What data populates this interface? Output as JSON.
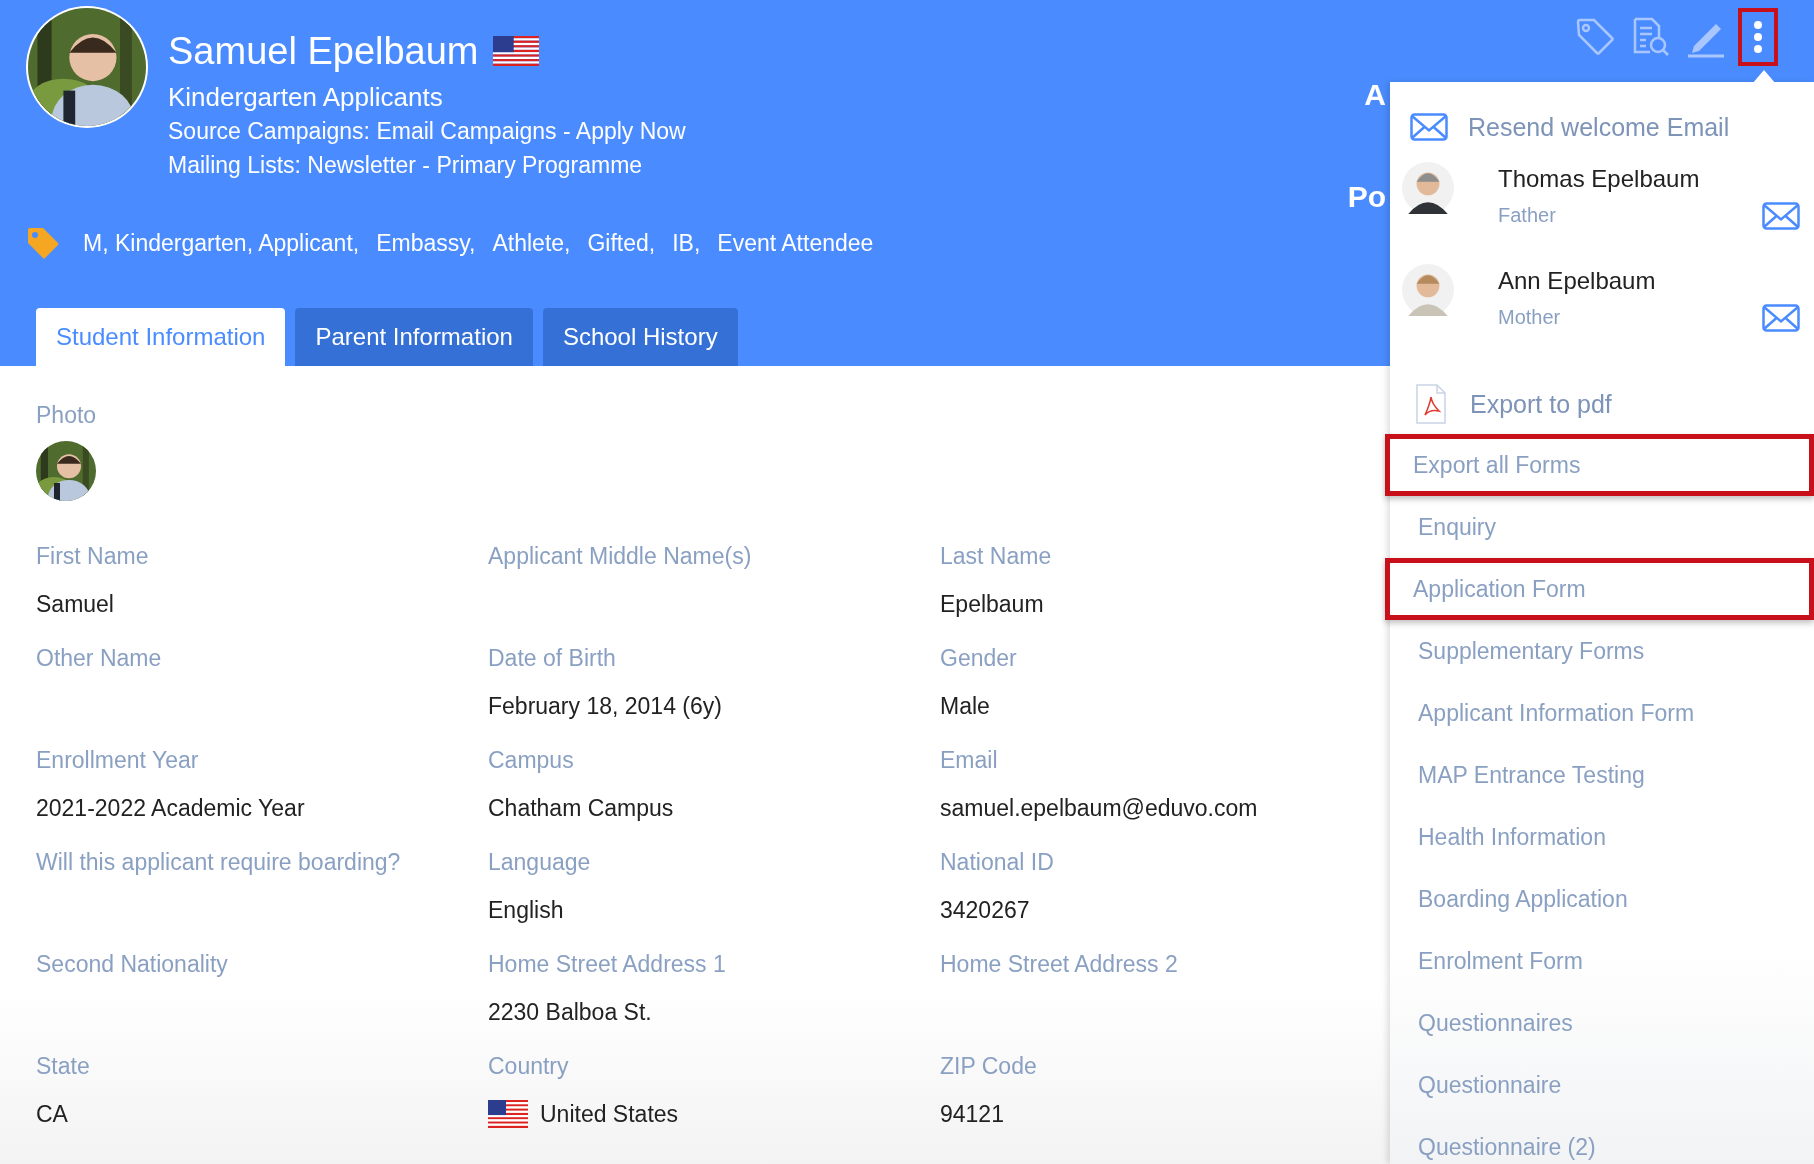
{
  "header": {
    "name": "Samuel Epelbaum",
    "group": "Kindergarten Applicants",
    "lines": [
      "Source Campaigns: Email Campaigns - Apply Now",
      "Mailing Lists: Newsletter - Primary Programme"
    ],
    "tags": [
      "M, Kindergarten, Applicant,",
      "Embassy,",
      "Athlete,",
      "Gifted,",
      "IB,",
      "Event Attendee"
    ],
    "partial_labels": [
      "A",
      "Po"
    ],
    "toolbar": [
      {
        "kind": "tag",
        "highlighted": false
      },
      {
        "kind": "search-doc",
        "highlighted": false
      },
      {
        "kind": "edit",
        "highlighted": false
      },
      {
        "kind": "more",
        "highlighted": true
      }
    ]
  },
  "tabs": [
    {
      "label": "Student Information",
      "selected": true
    },
    {
      "label": "Parent Information",
      "selected": false
    },
    {
      "label": "School History",
      "selected": false
    }
  ],
  "photo_label": "Photo",
  "fields": [
    {
      "label": "First Name",
      "value": "Samuel",
      "kind": "text"
    },
    {
      "label": "Applicant Middle Name(s)"
    },
    {
      "label": "Last Name",
      "value": "Epelbaum",
      "kind": "text"
    },
    {
      "label": "Other Name"
    },
    {
      "label": "Date of Birth",
      "value": "February 18, 2014 (6y)",
      "kind": "text"
    },
    {
      "label": "Gender",
      "value": "Male",
      "kind": "text"
    },
    {
      "label": "Enrollment Year",
      "value": "2021-2022 Academic Year",
      "kind": "text"
    },
    {
      "label": "Campus",
      "value": "Chatham Campus",
      "kind": "text"
    },
    {
      "label": "Email",
      "value": "samuel.epelbaum@eduvo.com",
      "kind": "text"
    },
    {
      "label": "Will this applicant require boarding?"
    },
    {
      "label": "Language",
      "value": "English",
      "kind": "text"
    },
    {
      "label": "National ID",
      "value": "3420267",
      "kind": "text"
    },
    {
      "label": "Second Nationality"
    },
    {
      "label": "Home Street Address 1",
      "value": "2230 Balboa St.",
      "kind": "text"
    },
    {
      "label": "Home Street Address 2"
    },
    {
      "label": "State",
      "value": "CA",
      "kind": "text"
    },
    {
      "label": "Country",
      "value": "United States",
      "kind": "country"
    },
    {
      "label": "ZIP Code",
      "value": "94121",
      "kind": "text"
    }
  ],
  "menu": {
    "resend": "Resend welcome Email",
    "contacts": [
      {
        "name": "Thomas Epelbaum",
        "role": "Father"
      },
      {
        "name": "Ann Epelbaum",
        "role": "Mother"
      }
    ],
    "export_pdf": "Export to pdf",
    "forms": [
      {
        "label": "Export all Forms",
        "highlighted": true
      },
      {
        "label": "Enquiry",
        "highlighted": false
      },
      {
        "label": "Application Form",
        "highlighted": true
      },
      {
        "label": "Supplementary Forms",
        "highlighted": false
      },
      {
        "label": "Applicant Information Form",
        "highlighted": false
      },
      {
        "label": "MAP Entrance Testing",
        "highlighted": false
      },
      {
        "label": "Health Information",
        "highlighted": false
      },
      {
        "label": "Boarding Application",
        "highlighted": false
      },
      {
        "label": "Enrolment Form",
        "highlighted": false
      },
      {
        "label": "Questionnaires",
        "highlighted": false
      },
      {
        "label": "Questionnaire",
        "highlighted": false
      },
      {
        "label": "Questionnaire (2)",
        "highlighted": false
      }
    ]
  }
}
